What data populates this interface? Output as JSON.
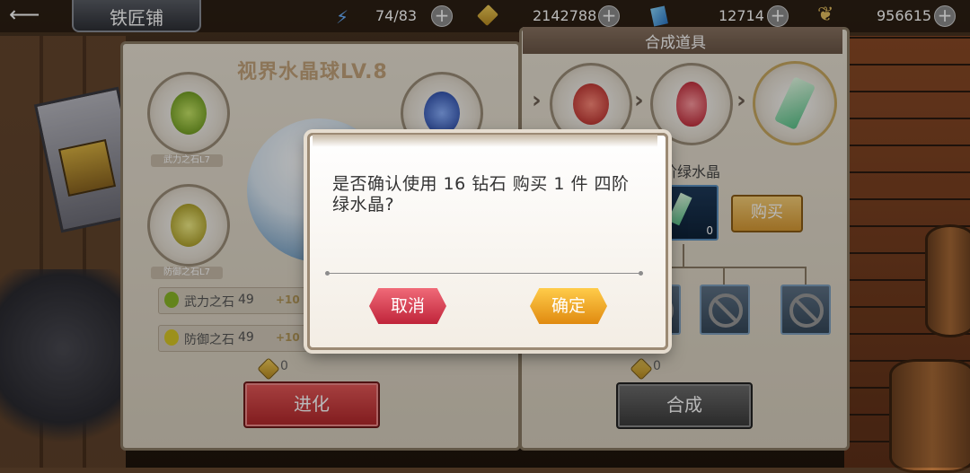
{
  "header": {
    "title": "铁匠铺",
    "resources": [
      {
        "name": "energy",
        "icon": "lightning-icon",
        "value": "74/83"
      },
      {
        "name": "gold",
        "icon": "gold-coin-icon",
        "value": "2142788"
      },
      {
        "name": "diamond",
        "icon": "diamond-icon",
        "value": "12714"
      },
      {
        "name": "honor",
        "icon": "laurel-icon",
        "value": "956615"
      }
    ]
  },
  "evolve_panel": {
    "title": "视界水晶球LV.8",
    "slots": [
      {
        "label": "武力之石L7",
        "color": "#8ab828"
      },
      {
        "label": "",
        "color": "#2c5ac8"
      },
      {
        "label": "防御之石L7",
        "color": "#d8c826"
      }
    ],
    "materials": [
      {
        "name": "武力之石",
        "count": "49",
        "bonus": "+10"
      },
      {
        "name": "防御之石",
        "count": "49",
        "bonus": "+10"
      }
    ],
    "cost": "0",
    "evolve_button": "进化"
  },
  "craft_panel": {
    "title": "合成道具",
    "item_name": "阶绿水晶",
    "item_count": "0",
    "buy_button": "购买",
    "cost": "0",
    "craft_button": "合成"
  },
  "dialog": {
    "message": "是否确认使用 16 钻石 购买 1 件 四阶绿水晶?",
    "cancel": "取消",
    "confirm": "确定"
  },
  "colors": {
    "cancel": "#d8344a",
    "confirm": "#f0a020"
  }
}
